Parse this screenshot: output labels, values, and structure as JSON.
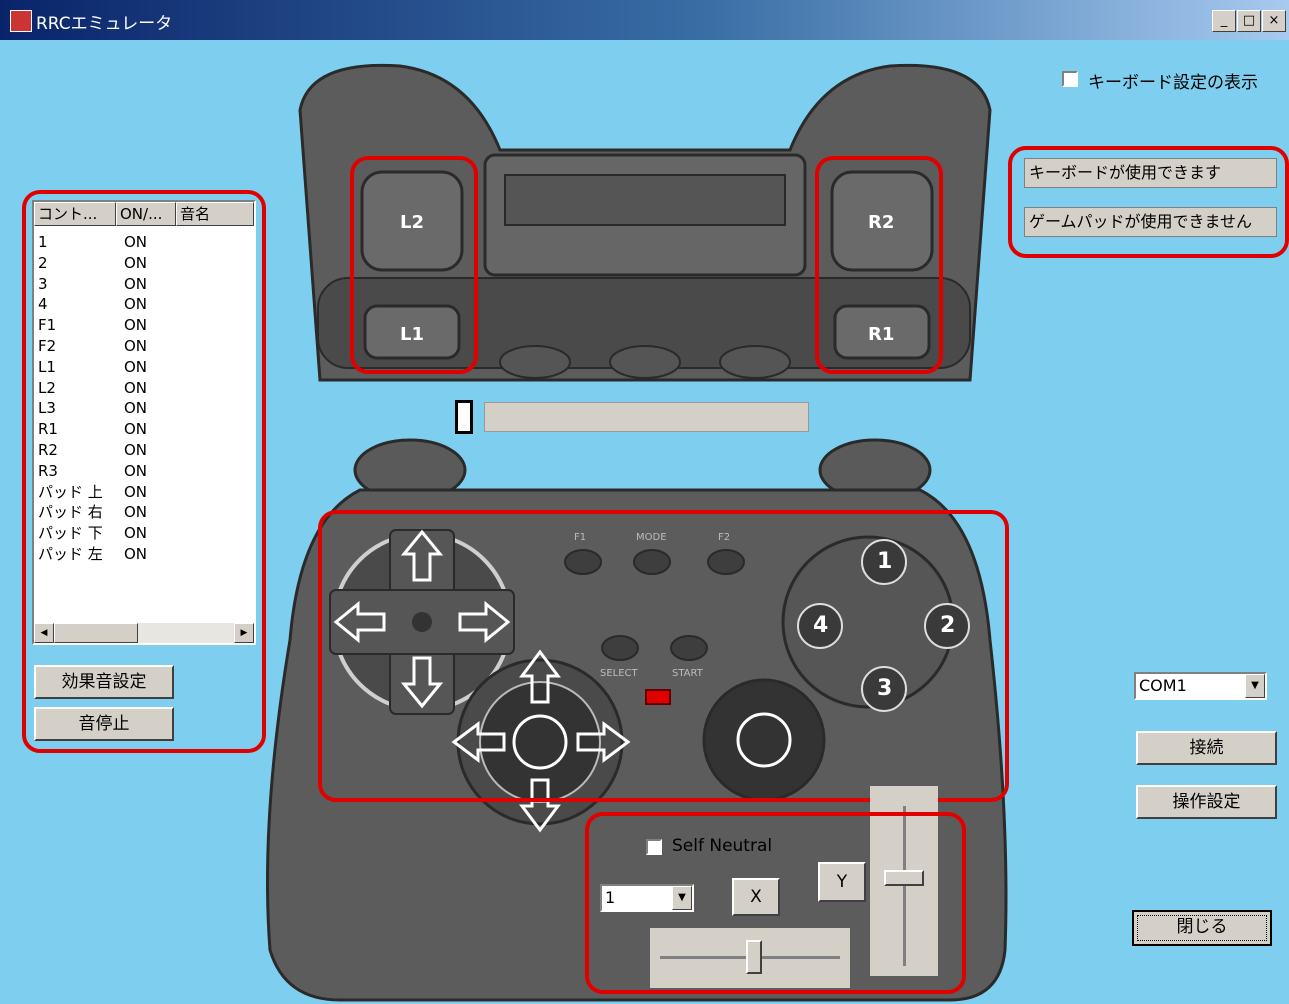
{
  "window": {
    "title": "RRCエミュレータ",
    "buttons": [
      "_",
      "□",
      "×"
    ]
  },
  "keyboard_settings_checkbox": {
    "label": "キーボード設定の表示",
    "checked": false
  },
  "status": {
    "keyboard": "キーボードが使用できます",
    "gamepad": "ゲームパッドが使用できません"
  },
  "sound_list": {
    "headers": [
      "コント...",
      "ON/...",
      "音名"
    ],
    "rows": [
      {
        "control": "1",
        "state": "ON"
      },
      {
        "control": "2",
        "state": "ON"
      },
      {
        "control": "3",
        "state": "ON"
      },
      {
        "control": "4",
        "state": "ON"
      },
      {
        "control": "F1",
        "state": "ON"
      },
      {
        "control": "F2",
        "state": "ON"
      },
      {
        "control": "L1",
        "state": "ON"
      },
      {
        "control": "L2",
        "state": "ON"
      },
      {
        "control": "L3",
        "state": "ON"
      },
      {
        "control": "R1",
        "state": "ON"
      },
      {
        "control": "R2",
        "state": "ON"
      },
      {
        "control": "R3",
        "state": "ON"
      },
      {
        "control": "パッド 上",
        "state": "ON"
      },
      {
        "control": "パッド 右",
        "state": "ON"
      },
      {
        "control": "パッド 下",
        "state": "ON"
      },
      {
        "control": "パッド 左",
        "state": "ON"
      }
    ]
  },
  "buttons_left": {
    "sound_settings": "効果音設定",
    "stop_sound": "音停止"
  },
  "controller": {
    "shoulder": {
      "l2": "L2",
      "l1": "L1",
      "r2": "R2",
      "r1": "R1"
    },
    "center_labels": {
      "f1": "F1",
      "mode": "MODE",
      "f2": "F2",
      "select": "SELECT",
      "start": "START"
    },
    "face": {
      "b1": "1",
      "b2": "2",
      "b3": "3",
      "b4": "4"
    }
  },
  "port": {
    "selected": "COM1"
  },
  "buttons_right": {
    "connect": "接続",
    "control_settings": "操作設定",
    "close": "閉じる"
  },
  "analog": {
    "self_neutral_label": "Self Neutral",
    "self_neutral_checked": false,
    "stick_select": "1",
    "x_label": "X",
    "y_label": "Y"
  },
  "colors": {
    "background": "#7ecfef",
    "highlight": "#e10000",
    "controller_body": "#5c5c5c"
  }
}
